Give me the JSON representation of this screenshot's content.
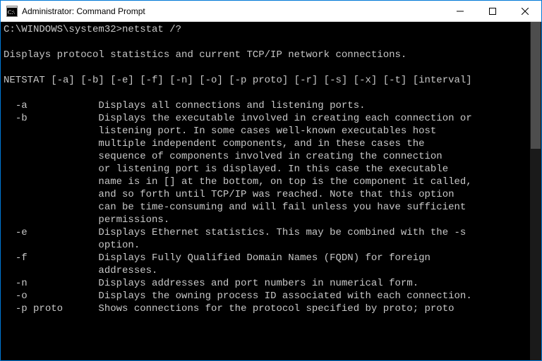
{
  "window": {
    "title": "Administrator: Command Prompt"
  },
  "terminal": {
    "prompt": "C:\\WINDOWS\\system32>",
    "command": "netstat /?",
    "description": "Displays protocol statistics and current TCP/IP network connections.",
    "usage": "NETSTAT [-a] [-b] [-e] [-f] [-n] [-o] [-p proto] [-r] [-s] [-x] [-t] [interval]",
    "options": [
      {
        "flag": "-a",
        "text": "Displays all connections and listening ports."
      },
      {
        "flag": "-b",
        "text": "Displays the executable involved in creating each connection or"
      },
      {
        "flag": "",
        "text": "listening port. In some cases well-known executables host"
      },
      {
        "flag": "",
        "text": "multiple independent components, and in these cases the"
      },
      {
        "flag": "",
        "text": "sequence of components involved in creating the connection"
      },
      {
        "flag": "",
        "text": "or listening port is displayed. In this case the executable"
      },
      {
        "flag": "",
        "text": "name is in [] at the bottom, on top is the component it called,"
      },
      {
        "flag": "",
        "text": "and so forth until TCP/IP was reached. Note that this option"
      },
      {
        "flag": "",
        "text": "can be time-consuming and will fail unless you have sufficient"
      },
      {
        "flag": "",
        "text": "permissions."
      },
      {
        "flag": "-e",
        "text": "Displays Ethernet statistics. This may be combined with the -s"
      },
      {
        "flag": "",
        "text": "option."
      },
      {
        "flag": "-f",
        "text": "Displays Fully Qualified Domain Names (FQDN) for foreign"
      },
      {
        "flag": "",
        "text": "addresses."
      },
      {
        "flag": "-n",
        "text": "Displays addresses and port numbers in numerical form."
      },
      {
        "flag": "-o",
        "text": "Displays the owning process ID associated with each connection."
      },
      {
        "flag": "-p proto",
        "text": "Shows connections for the protocol specified by proto; proto"
      }
    ]
  }
}
